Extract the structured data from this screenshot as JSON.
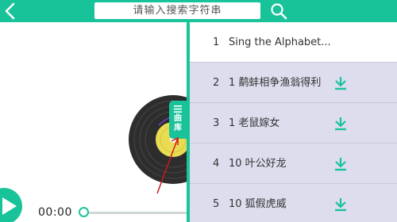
{
  "topbar": {
    "search_text": "请输入搜索字符串",
    "accent": "#19c39a"
  },
  "player": {
    "time": "00:00",
    "progress": 0
  },
  "library_tab": {
    "label": "曲库"
  },
  "songs": [
    {
      "index": "1",
      "title": "Sing the Alphabet...",
      "current": true,
      "download": false
    },
    {
      "index": "2",
      "title": "1   鹬蚌相争渔翁得利",
      "current": false,
      "download": true
    },
    {
      "index": "3",
      "title": "1  老鼠嫁女",
      "current": false,
      "download": true
    },
    {
      "index": "4",
      "title": "10   叶公好龙",
      "current": false,
      "download": true
    },
    {
      "index": "5",
      "title": "10   狐假虎威",
      "current": false,
      "download": true
    }
  ],
  "icons": {
    "back": "chevron-left-icon",
    "search": "search-icon",
    "download": "download-icon",
    "play": "play-icon",
    "menu": "menu-icon"
  }
}
